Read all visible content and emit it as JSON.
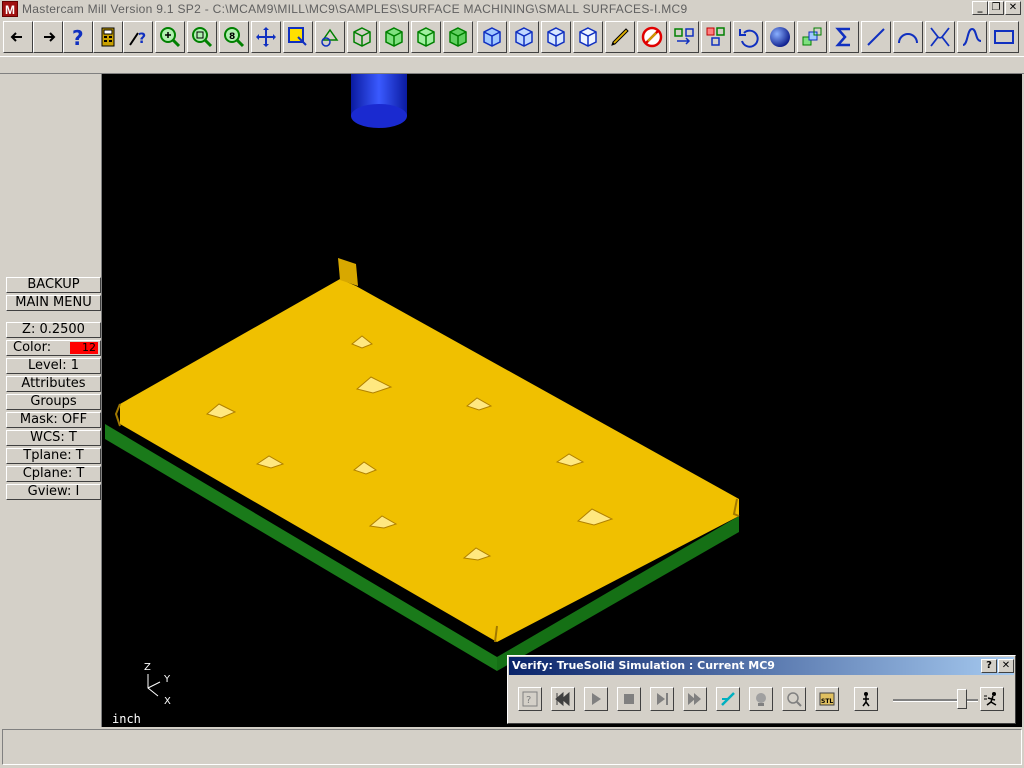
{
  "window": {
    "title": "Mastercam Mill Version 9.1 SP2 - C:\\MCAM9\\MILL\\MC9\\SAMPLES\\SURFACE MACHINING\\SMALL SURFACES-I.MC9",
    "app_icon_glyph": "M",
    "minimize_glyph": "_",
    "restore_glyph": "❐",
    "close_glyph": "✕"
  },
  "toolbar": {
    "buttons": [
      "back-arrow-icon",
      "forward-arrow-icon",
      "help-icon",
      "calculator-icon",
      "analyze-icon",
      "zoom-icon",
      "unzoom-icon",
      "zoom-window-icon",
      "pan-icon",
      "select-icon",
      "rotate-view-icon",
      "top-view-icon",
      "front-view-icon",
      "side-view-icon",
      "iso-view-icon",
      "cube-view-1-icon",
      "cube-view-2-icon",
      "cube-view-3-icon",
      "cube-view-4-icon",
      "pencil-icon",
      "delete-icon",
      "transform-icon",
      "xform-icon",
      "undo-icon",
      "sphere-icon",
      "layers-icon",
      "sigma-icon",
      "line-icon",
      "arc-icon",
      "fillet-icon",
      "spline-icon",
      "rectangle-icon"
    ]
  },
  "menu": {
    "backup": "BACKUP",
    "main_menu": "MAIN MENU",
    "z": "Z:  0.2500",
    "color_label": "Color:",
    "color_value": "12",
    "level": "Level:  1",
    "attributes": "Attributes",
    "groups": "Groups",
    "mask": "Mask:  OFF",
    "wcs": "WCS:   T",
    "tplane": "Tplane:  T",
    "cplane": "Cplane:  T",
    "gview": "Gview:   I"
  },
  "viewport": {
    "units": "inch",
    "axis_z": "Z",
    "axis_y": "Y",
    "axis_x": "X"
  },
  "verify": {
    "title": "Verify: TrueSolid Simulation : Current MC9",
    "help_glyph": "?",
    "close_glyph": "✕",
    "buttons": [
      "options-icon",
      "rewind-icon",
      "play-icon",
      "stop-icon",
      "step-icon",
      "fast-forward-icon",
      "tool-display-icon",
      "light-icon",
      "zoom-fit-icon",
      "stl-save-icon",
      "speed-slow-icon",
      "speed-fast-icon"
    ],
    "speed_fraction": 0.85
  }
}
